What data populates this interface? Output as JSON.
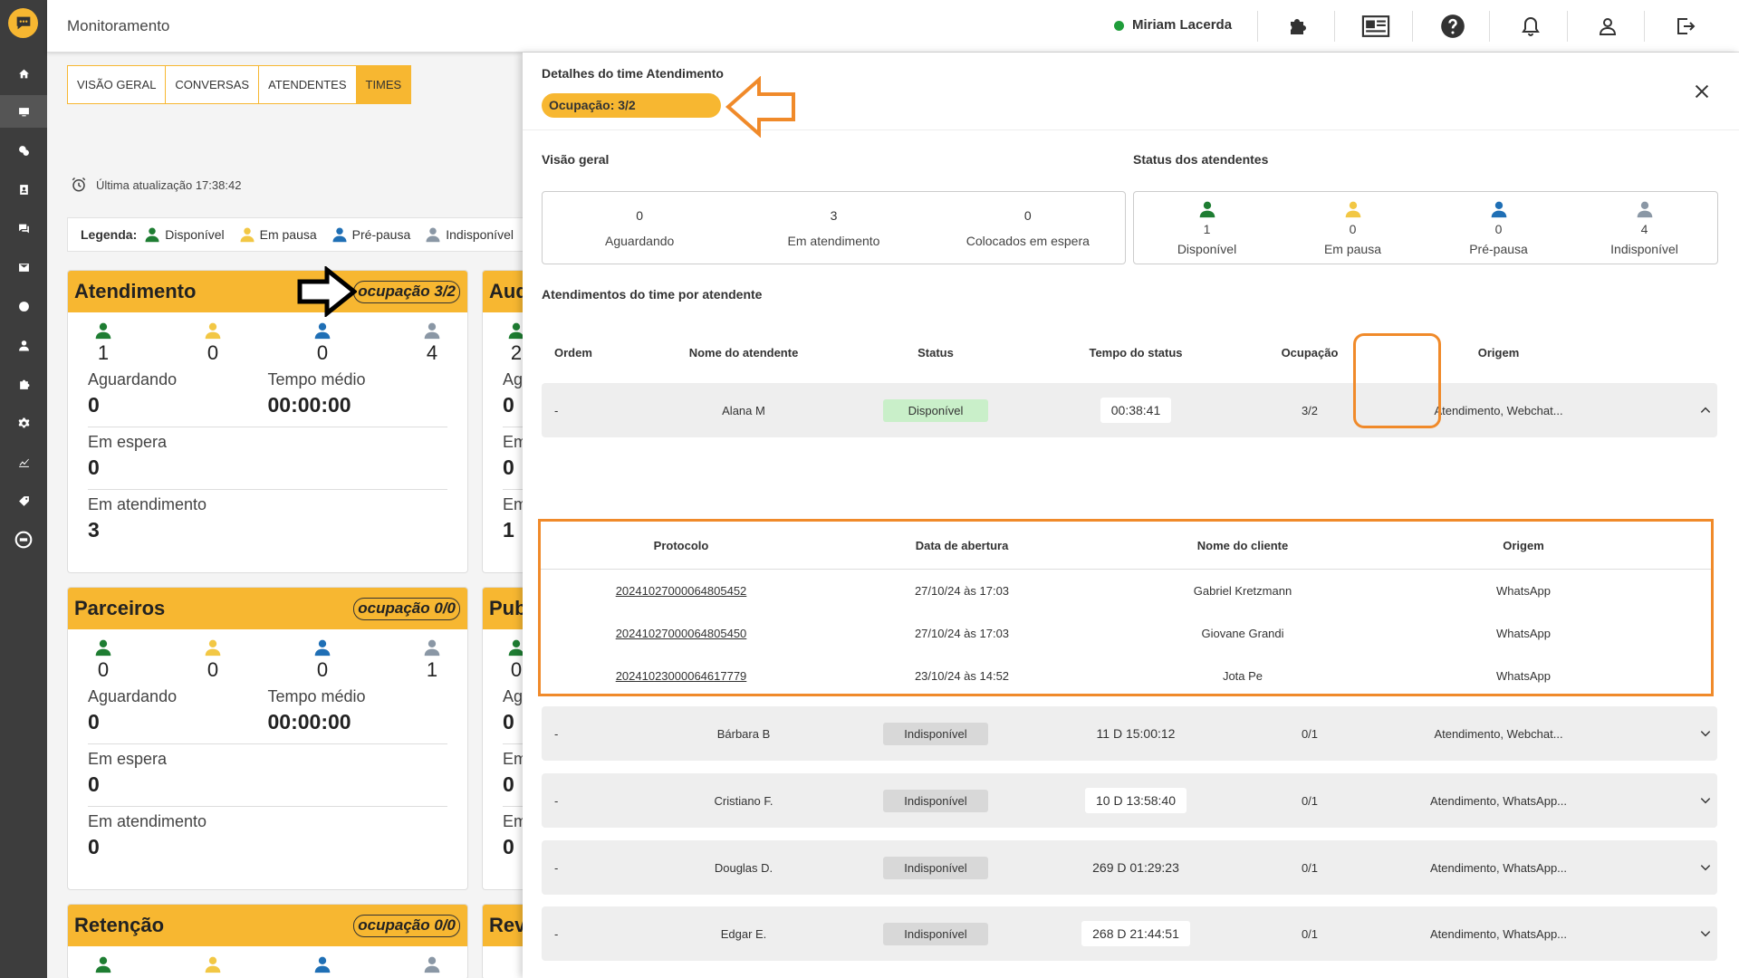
{
  "app": {
    "title": "Monitoramento",
    "user_name": "Miriam Lacerda",
    "online_color": "#1f9d3a",
    "brand_color": "#f7b731"
  },
  "sidebar": {
    "items": [
      {
        "icon": "home-icon"
      },
      {
        "icon": "monitor-icon"
      },
      {
        "icon": "coins-icon"
      },
      {
        "icon": "contacts-icon"
      },
      {
        "icon": "chat-icon"
      },
      {
        "icon": "mail-icon"
      },
      {
        "icon": "globe-icon"
      },
      {
        "icon": "user-icon"
      },
      {
        "icon": "puzzle-icon"
      },
      {
        "icon": "gear-icon"
      },
      {
        "icon": "chart-icon"
      },
      {
        "icon": "tag-icon"
      },
      {
        "icon": "api-icon"
      }
    ]
  },
  "tabs": [
    "VISÃO GERAL",
    "CONVERSAS",
    "ATENDENTES",
    "TIMES"
  ],
  "last_update": "Última atualização 17:38:42",
  "legend": {
    "title": "Legenda:",
    "items": [
      "Disponível",
      "Em pausa",
      "Pré-pausa",
      "Indisponível"
    ]
  },
  "cards": [
    {
      "title": "Atendimento",
      "occupancy": "ocupação 3/2",
      "counts": [
        "1",
        "0",
        "0",
        "4"
      ],
      "aguardando_label": "Aguardando",
      "aguardando": "0",
      "tempo_label": "Tempo médio",
      "tempo": "00:00:00",
      "espera_label": "Em espera",
      "espera": "0",
      "atendimento_label": "Em atendimento",
      "atendimento": "3"
    },
    {
      "title": "Parceiros",
      "occupancy": "ocupação 0/0",
      "counts": [
        "0",
        "0",
        "0",
        "1"
      ],
      "aguardando_label": "Aguardando",
      "aguardando": "0",
      "tempo_label": "Tempo médio",
      "tempo": "00:00:00",
      "espera_label": "Em espera",
      "espera": "0",
      "atendimento_label": "Em atendimento",
      "atendimento": "0"
    },
    {
      "title": "Retenção",
      "occupancy": "ocupação 0/0"
    }
  ],
  "cards_partial": [
    {
      "title": "Aud",
      "count": "2",
      "l1": "Ag",
      "v1": "0",
      "l2": "Em",
      "v2": "0",
      "l3": "Em",
      "v3": "1"
    },
    {
      "title": "Pub",
      "count": "0",
      "l1": "Ag",
      "v1": "0",
      "l2": "Em",
      "v2": "0",
      "l3": "Em",
      "v3": "0"
    },
    {
      "title": "Rev"
    }
  ],
  "panel": {
    "title": "Detalhes do time Atendimento",
    "occupancy": "Ocupação: 3/2",
    "overview_title": "Visão geral",
    "overview": [
      {
        "value": "0",
        "label": "Aguardando"
      },
      {
        "value": "3",
        "label": "Em atendimento"
      },
      {
        "value": "0",
        "label": "Colocados em espera"
      }
    ],
    "status_title": "Status dos atendentes",
    "status": [
      {
        "value": "1",
        "label": "Disponível",
        "color": "#1e7d32"
      },
      {
        "value": "0",
        "label": "Em pausa",
        "color": "#f2c744"
      },
      {
        "value": "0",
        "label": "Pré-pausa",
        "color": "#1f6fb5"
      },
      {
        "value": "4",
        "label": "Indisponível",
        "color": "#8a97a5"
      }
    ],
    "table_title": "Atendimentos do time por atendente",
    "columns": [
      "Ordem",
      "Nome do atendente",
      "Status",
      "Tempo do status",
      "Ocupação",
      "Origem"
    ],
    "rows": [
      {
        "ordem": "-",
        "nome": "Alana M",
        "status": "Disponível",
        "tempo": "00:38:41",
        "occ": "3/2",
        "origem": "Atendimento, Webchat..."
      },
      {
        "ordem": "-",
        "nome": "Bárbara B",
        "status": "Indisponível",
        "tempo": "11 D 15:00:12",
        "occ": "0/1",
        "origem": "Atendimento, Webchat..."
      },
      {
        "ordem": "-",
        "nome": "Cristiano F.",
        "status": "Indisponível",
        "tempo": "10 D 13:58:40",
        "occ": "0/1",
        "origem": "Atendimento, WhatsApp..."
      },
      {
        "ordem": "-",
        "nome": "Douglas D.",
        "status": "Indisponível",
        "tempo": "269 D 01:29:23",
        "occ": "0/1",
        "origem": "Atendimento, WhatsApp..."
      },
      {
        "ordem": "-",
        "nome": "Edgar E.",
        "status": "Indisponível",
        "tempo": "268 D 21:44:51",
        "occ": "0/1",
        "origem": "Atendimento, WhatsApp..."
      }
    ],
    "sub_columns": [
      "Protocolo",
      "Data de abertura",
      "Nome do cliente",
      "Origem"
    ],
    "sub_rows": [
      {
        "protocolo": "20241027000064805452",
        "data": "27/10/24 às 17:03",
        "cliente": "Gabriel Kretzmann",
        "origem": "WhatsApp"
      },
      {
        "protocolo": "20241027000064805450",
        "data": "27/10/24 às 17:03",
        "cliente": "Giovane Grandi",
        "origem": "WhatsApp"
      },
      {
        "protocolo": "20241023000064617779",
        "data": "23/10/24 às 14:52",
        "cliente": "Jota Pe",
        "origem": "WhatsApp"
      }
    ]
  },
  "colors": {
    "disponivel": "#1e7d32",
    "em_pausa": "#f2c744",
    "pre_pausa": "#1f6fb5",
    "indisponivel": "#8a97a5",
    "annotation": "#f08a2a"
  }
}
